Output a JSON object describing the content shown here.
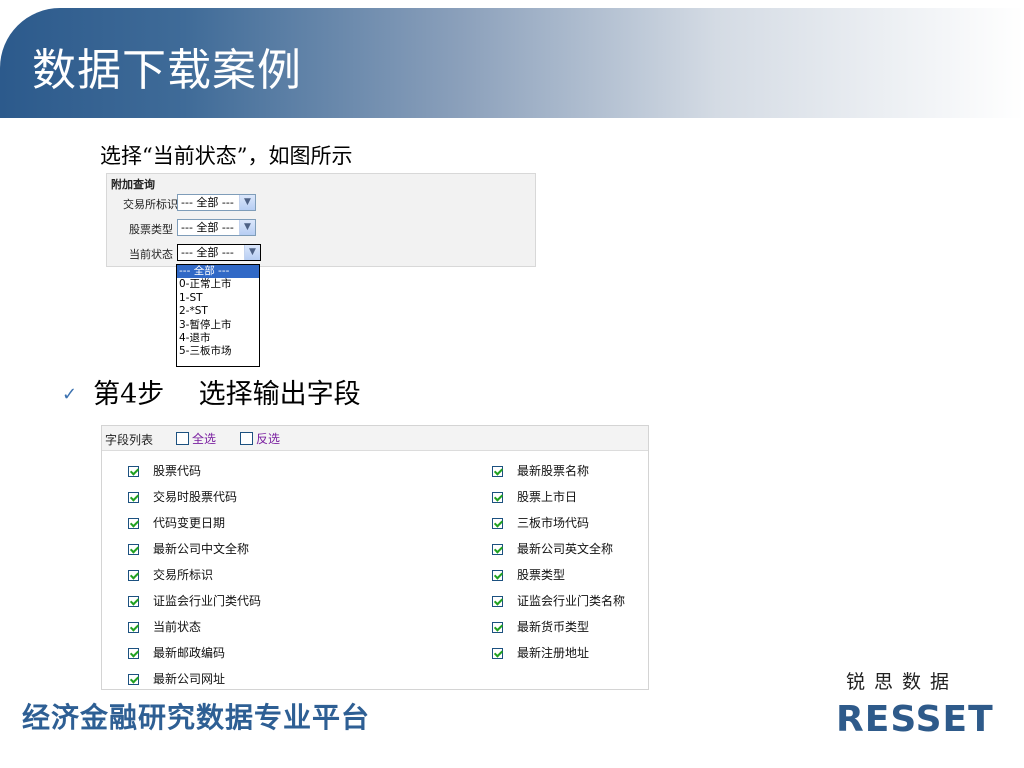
{
  "header": {
    "title": "数据下载案例"
  },
  "intro": "选择“当前状态”，如图所示",
  "query_panel": {
    "title": "附加查询",
    "rows": [
      {
        "label": "交易所标识",
        "value": "--- 全部 ---"
      },
      {
        "label": "股票类型",
        "value": "--- 全部 ---"
      },
      {
        "label": "当前状态",
        "value": "--- 全部 ---"
      }
    ],
    "dropdown_options": [
      "--- 全部 ---",
      "0-正常上市",
      "1-ST",
      "2-*ST",
      "3-暂停上市",
      "4-退市",
      "5-三板市场"
    ],
    "selected_option": "--- 全部 ---"
  },
  "step": {
    "check_icon": "✓",
    "label": "第4步    选择输出字段"
  },
  "field_list": {
    "header_label": "字段列表",
    "select_all": "全选",
    "invert_select": "反选",
    "left_fields": [
      "股票代码",
      "交易时股票代码",
      "代码变更日期",
      "最新公司中文全称",
      "交易所标识",
      "证监会行业门类代码",
      "当前状态",
      "最新邮政编码",
      "最新公司网址"
    ],
    "right_fields": [
      "最新股票名称",
      "股票上市日",
      "三板市场代码",
      "最新公司英文全称",
      "股票类型",
      "证监会行业门类名称",
      "最新货币类型",
      "最新注册地址"
    ]
  },
  "footer": {
    "platform_text": "经济金融研究数据专业平台",
    "logo_cn": "锐思数据",
    "logo_en": "RESSET"
  },
  "colors": {
    "accent": "#2e5f94",
    "header_dark": "#2c5a8c",
    "link_purple": "#7a1fa0",
    "check_green": "#21a121",
    "selected_blue": "#3169c6"
  }
}
